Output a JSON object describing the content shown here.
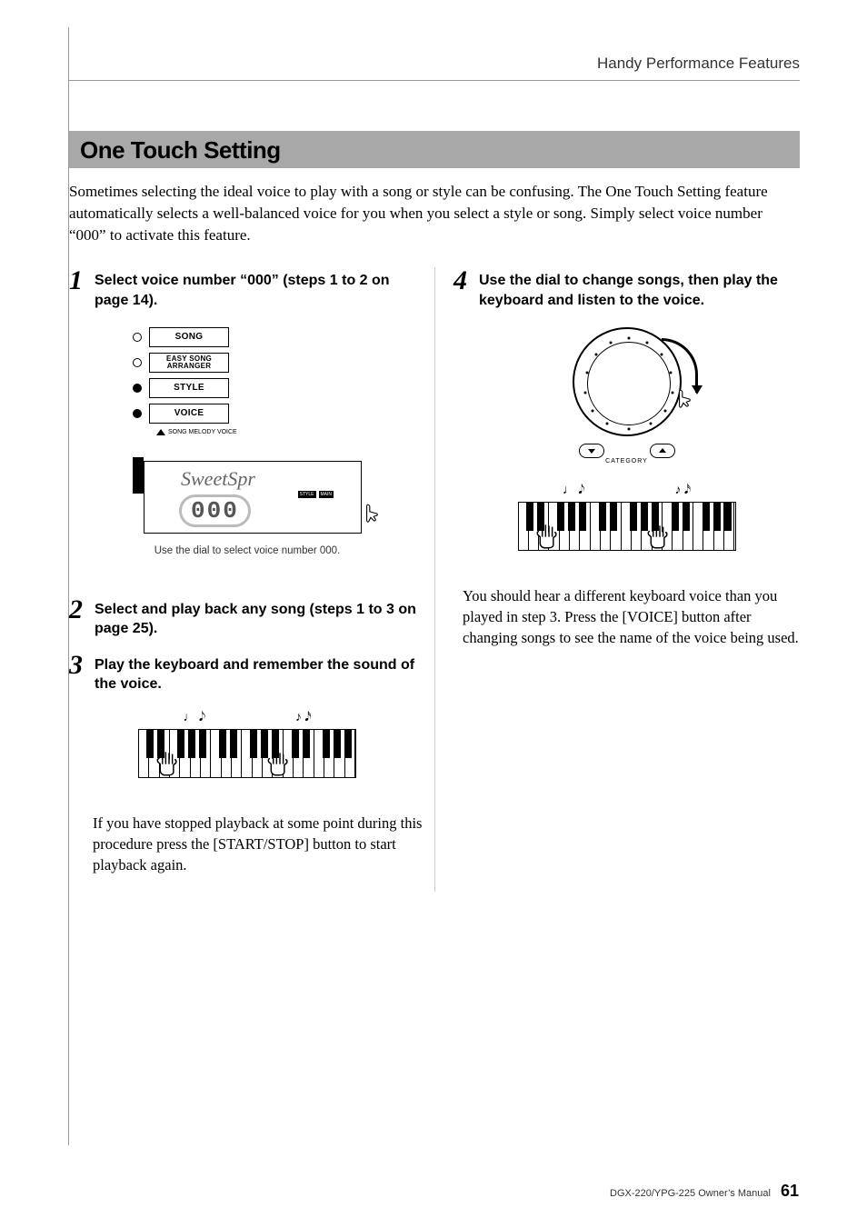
{
  "header": {
    "section_name": "Handy Performance Features"
  },
  "title": "One Touch Setting",
  "intro": "Sometimes selecting the ideal voice to play with a song or style can be confusing. The One Touch Setting feature automatically selects a well-balanced voice for you when you select a style or song. Simply select voice number “000” to activate this feature.",
  "steps": [
    {
      "num": "1",
      "text": "Select voice number “000” (steps 1 to 2 on page 14)."
    },
    {
      "num": "2",
      "text": "Select and play back any song (steps 1 to 3 on page 25)."
    },
    {
      "num": "3",
      "text": "Play the keyboard and remember the sound of the voice."
    },
    {
      "num": "4",
      "text": "Use the dial to change songs, then play the keyboard and listen to the voice."
    }
  ],
  "step3_body": "If you have stopped playback at some point during this procedure press the [START/STOP] button to start playback again.",
  "step4_body": "You should hear a different keyboard voice than you played in step 3.  Press the [VOICE] button after changing songs to see the name of the voice being used.",
  "panel": {
    "buttons": [
      "SONG",
      "EASY SONG\nARRANGER",
      "STYLE",
      "VOICE"
    ],
    "sublabel": "SONG MELODY VOICE"
  },
  "lcd": {
    "voice_name": "SweetSpr",
    "voice_number": "000",
    "caption": "Use the dial to select voice number 000."
  },
  "dial": {
    "category_label": "CATEGORY"
  },
  "footer": {
    "manual": "DGX-220/YPG-225  Owner’s Manual",
    "page": "61"
  }
}
